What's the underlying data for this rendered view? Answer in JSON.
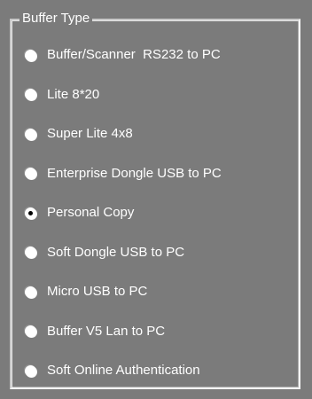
{
  "group": {
    "title": "Buffer Type"
  },
  "options": [
    {
      "label": "Buffer/Scanner  RS232 to PC",
      "checked": false
    },
    {
      "label": "Lite 8*20",
      "checked": false
    },
    {
      "label": "Super Lite 4x8",
      "checked": false
    },
    {
      "label": "Enterprise Dongle USB to PC",
      "checked": false
    },
    {
      "label": "Personal Copy",
      "checked": true
    },
    {
      "label": "Soft Dongle USB to PC",
      "checked": false
    },
    {
      "label": "Micro USB to PC",
      "checked": false
    },
    {
      "label": "Buffer V5 Lan to PC",
      "checked": false
    },
    {
      "label": "Soft Online Authentication",
      "checked": false
    }
  ],
  "colors": {
    "background": "#7b7b7b",
    "text": "#ffffff"
  }
}
